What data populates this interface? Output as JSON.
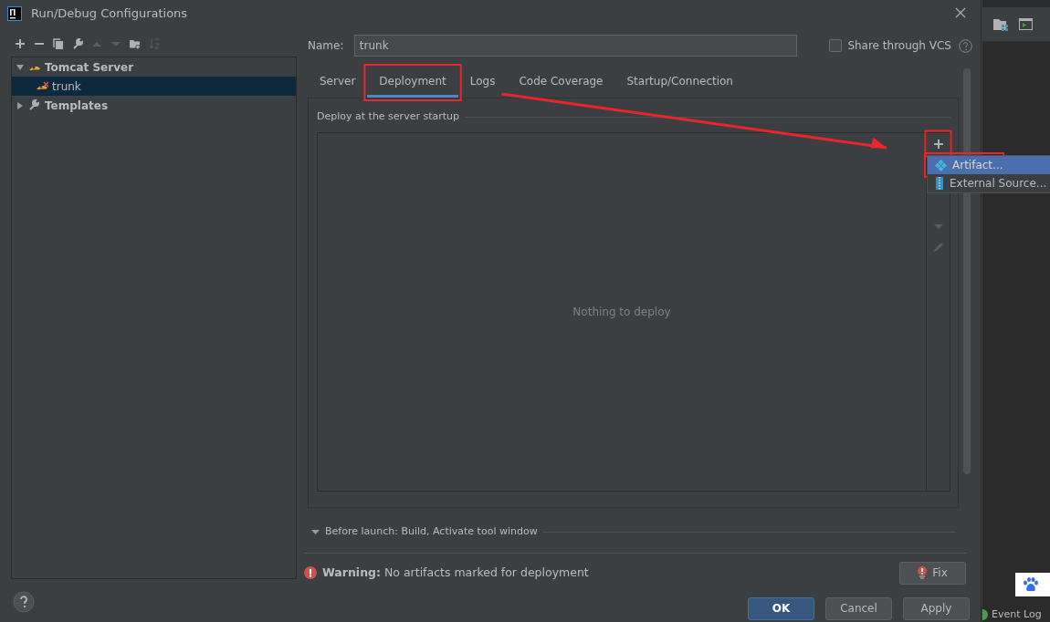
{
  "window": {
    "title": "Run/Debug Configurations"
  },
  "toolbar": [
    {
      "kind": "add",
      "disabled": false
    },
    {
      "kind": "remove",
      "disabled": false
    },
    {
      "kind": "copy",
      "disabled": false
    },
    {
      "kind": "wrench",
      "disabled": false
    },
    {
      "kind": "up",
      "disabled": true
    },
    {
      "kind": "down",
      "disabled": true
    },
    {
      "kind": "folder",
      "disabled": false
    },
    {
      "kind": "sort",
      "disabled": true
    }
  ],
  "tree": [
    {
      "label": "Tomcat Server",
      "kind": "tomcat",
      "expanded": true,
      "selected": false,
      "children": [
        {
          "label": "trunk",
          "kind": "tomcat-error",
          "selected": true
        }
      ]
    },
    {
      "label": "Templates",
      "kind": "wrench",
      "expanded": false,
      "selected": false
    }
  ],
  "name_field": {
    "label": "Name:",
    "value": "trunk"
  },
  "share": {
    "label": "Share through VCS",
    "checked": false
  },
  "tabs": [
    {
      "label": "Server",
      "selected": false
    },
    {
      "label": "Deployment",
      "selected": true
    },
    {
      "label": "Logs",
      "selected": false
    },
    {
      "label": "Code Coverage",
      "selected": false
    },
    {
      "label": "Startup/Connection",
      "selected": false
    }
  ],
  "deploy": {
    "title": "Deploy at the server startup",
    "empty_text": "Nothing to deploy"
  },
  "popup_menu": [
    {
      "label": "Artifact...",
      "kind": "artifact",
      "selected": true
    },
    {
      "label": "External Source...",
      "kind": "archive",
      "selected": false
    }
  ],
  "before_launch": {
    "label": "Before launch: Build, Activate tool window",
    "expanded": true
  },
  "warning": {
    "text": "**Warning:** No artifacts marked for deployment"
  },
  "fix_button": "Fix",
  "buttons": [
    {
      "label": "OK",
      "kind": "primary"
    },
    {
      "label": "Cancel",
      "kind": "plain"
    },
    {
      "label": "Apply",
      "kind": "plain"
    }
  ],
  "ide": {
    "status_text": "Event Log"
  },
  "annotations": [
    {
      "kind": "box"
    },
    {
      "kind": "box"
    },
    {
      "kind": "box"
    },
    {
      "kind": "arrow"
    }
  ]
}
